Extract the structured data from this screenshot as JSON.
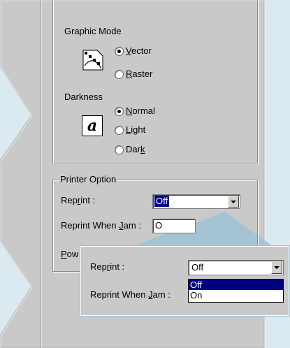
{
  "graphic_mode": {
    "title": "Graphic Mode",
    "options": [
      {
        "label_pre": "",
        "label_u": "V",
        "label_post": "ector",
        "selected": true
      },
      {
        "label_pre": "",
        "label_u": "R",
        "label_post": "aster",
        "selected": false
      }
    ]
  },
  "darkness": {
    "title": "Darkness",
    "icon_glyph": "a",
    "options": [
      {
        "label_pre": "",
        "label_u": "N",
        "label_post": "ormal",
        "selected": true
      },
      {
        "label_pre": "",
        "label_u": "L",
        "label_post": "ight",
        "selected": false
      },
      {
        "label_pre": "Dar",
        "label_u": "k",
        "label_post": "",
        "selected": false
      }
    ]
  },
  "printer_option": {
    "title": "Printer Option",
    "reprint_label_pre": "Rep",
    "reprint_label_u": "r",
    "reprint_label_post": "int :",
    "reprint_value": "Off",
    "reprint_jam_label_pre": "Reprint When ",
    "reprint_jam_label_u": "J",
    "reprint_jam_label_post": "am :",
    "reprint_jam_value": "O",
    "power_label_u": "P",
    "power_label_post": "ow"
  },
  "callout": {
    "reprint_label_pre": "Rep",
    "reprint_label_u": "r",
    "reprint_label_post": "int :",
    "reprint_value": "Off",
    "reprint_jam_label_pre": "Reprint When ",
    "reprint_jam_label_u": "J",
    "reprint_jam_label_post": "am :",
    "dropdown_options": [
      "Off",
      "On"
    ],
    "dropdown_selected_index": 0
  },
  "colors": {
    "background": "#dbeaf1",
    "panel": "#c9c9c9",
    "highlight": "#000080"
  }
}
